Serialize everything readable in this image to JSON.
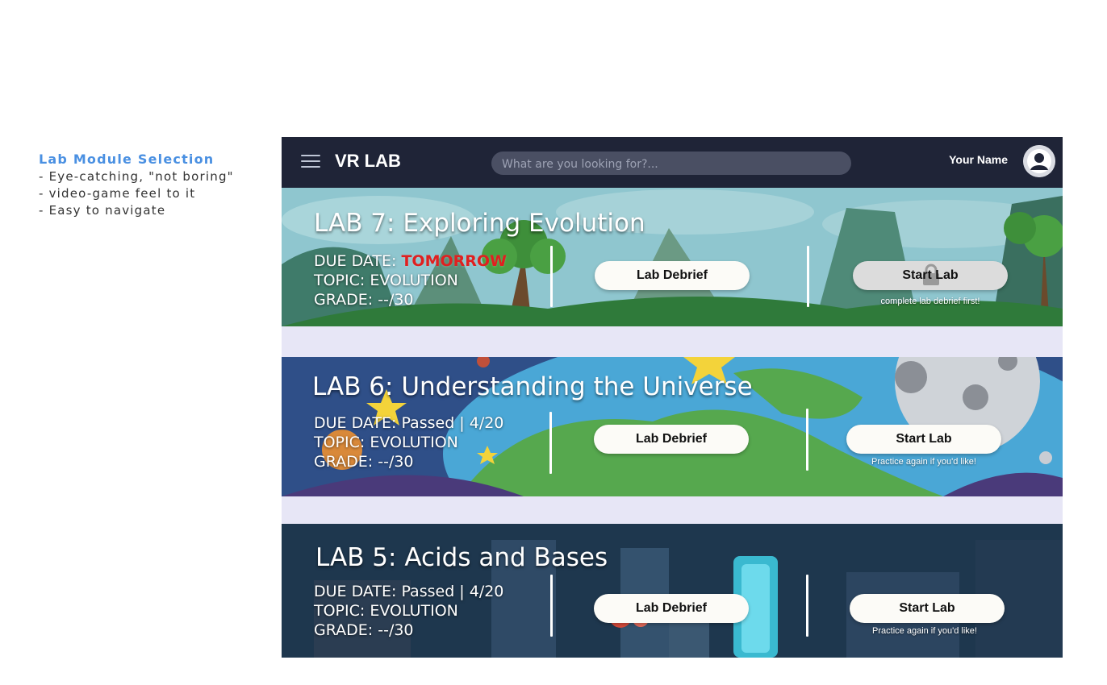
{
  "notes": {
    "title": "Lab Module Selection",
    "lines": [
      "- Eye-catching, \"not boring\"",
      "- video-game feel to it",
      "- Easy to navigate"
    ]
  },
  "topbar": {
    "brand": "VR LAB",
    "search_placeholder": "What are you looking for?...",
    "user_name": "Your Name",
    "menu_icon": "hamburger-menu-icon",
    "avatar_icon": "user-avatar-icon"
  },
  "labs": [
    {
      "title": "LAB 7: Exploring Evolution",
      "due_label": "DUE DATE: ",
      "due_value": "TOMORROW",
      "topic": "TOPIC: EVOLUTION",
      "grade": "GRADE: --/30",
      "debrief_label": "Lab Debrief",
      "start_label": "Start Lab",
      "start_hint": "complete lab debrief first!",
      "locked": true
    },
    {
      "title": "LAB 6: Understanding the Universe",
      "due_label": "DUE DATE: ",
      "due_value": "Passed | 4/20",
      "topic": "TOPIC: EVOLUTION",
      "grade": "GRADE: --/30",
      "debrief_label": "Lab Debrief",
      "start_label": "Start Lab",
      "start_hint": "Practice again if you'd like!",
      "locked": false
    },
    {
      "title": "LAB 5: Acids and Bases",
      "due_label": "DUE DATE: ",
      "due_value": "Passed | 4/20",
      "topic": "TOPIC: EVOLUTION",
      "grade": "GRADE: --/30",
      "debrief_label": "Lab Debrief",
      "start_label": "Start Lab",
      "start_hint": "Practice again if you'd like!",
      "locked": false
    }
  ],
  "colors": {
    "topbar": "#1f2437",
    "page_bg": "#e7e6f6",
    "urgent": "#e02020",
    "notes_title": "#4a90e2"
  }
}
